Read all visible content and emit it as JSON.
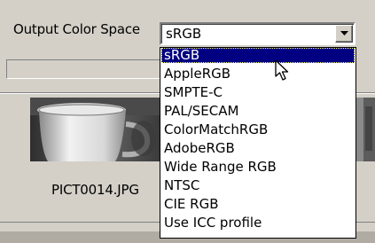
{
  "output_color_space": {
    "label": "Output Color Space",
    "selected": "sRGB",
    "options": [
      "sRGB",
      "AppleRGB",
      "SMPTE-C",
      "PAL/SECAM",
      "ColorMatchRGB",
      "AdobeRGB",
      "Wide Range RGB",
      "NTSC",
      "CIE RGB",
      "Use ICC profile"
    ],
    "highlighted_index": 0
  },
  "thumbnail": {
    "filename": "PICT0014.JPG"
  },
  "icons": {
    "combo_arrow": "chevron-down-icon",
    "cursor": "mouse-pointer-icon"
  },
  "colors": {
    "highlight": "#000080",
    "window_bg": "#d4d0c8"
  }
}
